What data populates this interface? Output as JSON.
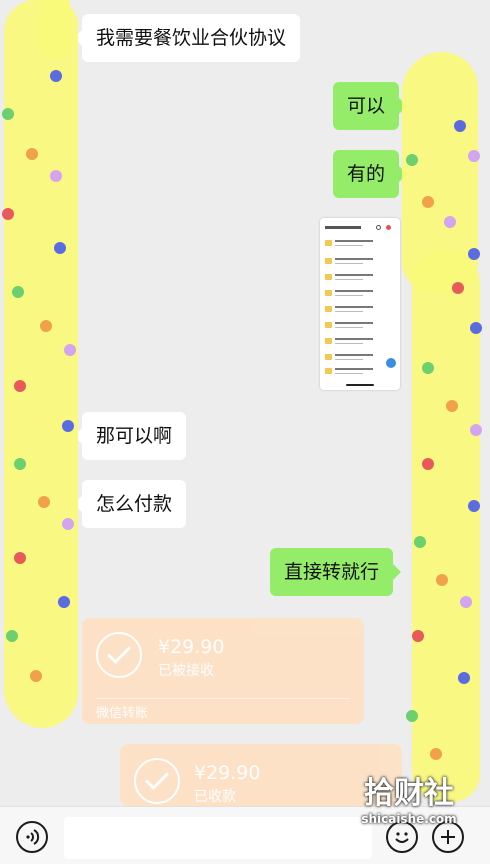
{
  "messages": [
    {
      "side": "left",
      "text": "我需要餐饮业合伙协议"
    },
    {
      "side": "right",
      "text": "可以"
    },
    {
      "side": "right",
      "text": "有的"
    },
    {
      "side": "left",
      "text": "那可以啊"
    },
    {
      "side": "left",
      "text": "怎么付款"
    },
    {
      "side": "right",
      "text": "直接转就行"
    }
  ],
  "transfers": [
    {
      "amount": "¥29.90",
      "status": "已被接收",
      "footer": "微信转账"
    },
    {
      "amount": "¥29.90",
      "status": "已收款"
    }
  ],
  "bottombar": {
    "voice_icon": "voice-icon",
    "emoji_icon": "emoji-icon",
    "add_icon": "plus-icon"
  },
  "watermark": {
    "main": "拾财社",
    "sub": "shicaishe.com"
  },
  "colors": {
    "background": "#ededed",
    "left_bubble": "#ffffff",
    "right_bubble": "#95ec69",
    "transfer": "#fde1c5",
    "scribble": "#f8f87a"
  }
}
